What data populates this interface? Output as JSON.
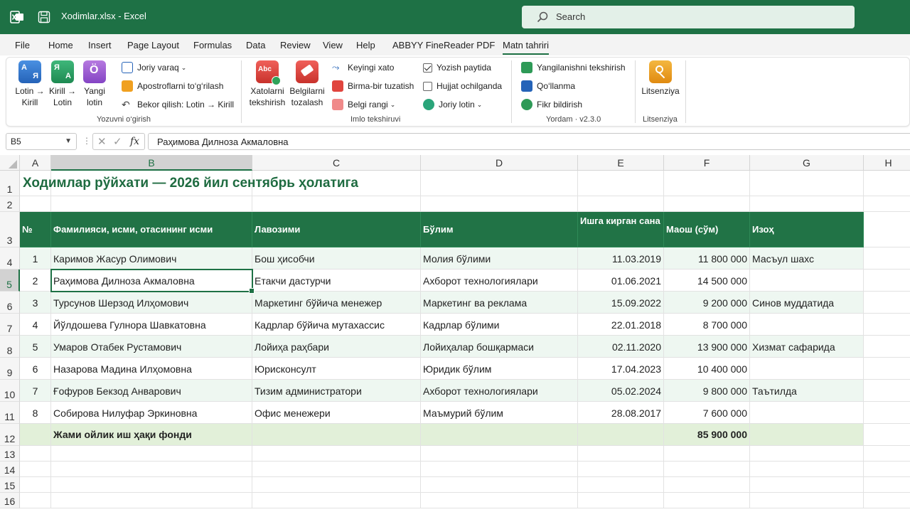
{
  "window": {
    "title": "Xodimlar.xlsx  -  Excel",
    "search_placeholder": "Search"
  },
  "menu": [
    "File",
    "Home",
    "Insert",
    "Page Layout",
    "Formulas",
    "Data",
    "Review",
    "View",
    "Help",
    "ABBYY FineReader PDF",
    "Matn tahriri"
  ],
  "active_menu": "Matn tahriri",
  "ribbon": {
    "group1": {
      "label": "Yozuvni o‘girish",
      "lotin_kirill": [
        "Lotin →",
        "Kirill"
      ],
      "kirill_lotin": [
        "Kirill →",
        "Lotin"
      ],
      "yangi_lotin": [
        "Yangi",
        "lotin"
      ],
      "joriy_varaq": "Joriy varaq",
      "apostrof": "Apostroflarni to‘g‘rilash",
      "bekor": "Bekor qilish: Lotin → Kirill"
    },
    "group2": {
      "label": "Imlo tekshiruvi",
      "xatolarni": [
        "Xatolarni",
        "tekshirish"
      ],
      "belgilarni": [
        "Belgilarni",
        "tozalash"
      ],
      "keyingi_xato": "Keyingi xato",
      "birma_bir": "Birma-bir tuzatish",
      "belgi_rangi": "Belgi rangi",
      "yozish_paytida": "Yozish paytida",
      "hujjat_ochilganda": "Hujjat ochilganda",
      "joriy_lotin": "Joriy lotin"
    },
    "group3": {
      "label": "Yordam · v2.3.0",
      "yangilanish": "Yangilanishni tekshirish",
      "qollanma": "Qo‘llanma",
      "fikr": "Fikr bildirish"
    },
    "group4": {
      "label": "Litsenziya",
      "litsenziya": "Litsenziya"
    }
  },
  "formula_bar": {
    "name_box": "B5",
    "formula": "Раҳимова Дилноза Акмаловна"
  },
  "columns": [
    "A",
    "B",
    "C",
    "D",
    "E",
    "F",
    "G",
    "H"
  ],
  "selected_column": "B",
  "selected_row": "5",
  "rows_numbers": [
    "1",
    "2",
    "3",
    "4",
    "5",
    "6",
    "7",
    "8",
    "9",
    "10",
    "11",
    "12",
    "13",
    "14",
    "15",
    "16"
  ],
  "sheet": {
    "title": "Ходимлар рўйхати — 2026 йил сентябрь ҳолатига",
    "headers": [
      "№",
      "Фамилияси, исми, отасининг исми",
      "Лавозими",
      "Бўлим",
      "Ишга кирган сана",
      "Маош (сўм)",
      "Изоҳ"
    ],
    "rows": [
      [
        "1",
        "Каримов Жасур Олимович",
        "Бош ҳисобчи",
        "Молия бўлими",
        "11.03.2019",
        "11 800 000",
        "Масъул шахс"
      ],
      [
        "2",
        "Раҳимова Дилноза Акмаловна",
        "Етакчи дастурчи",
        "Ахборот технологиялари",
        "01.06.2021",
        "14 500 000",
        ""
      ],
      [
        "3",
        "Турсунов Шерзод Илҳомович",
        "Маркетинг бўйича менежер",
        "Маркетинг ва реклама",
        "15.09.2022",
        "9 200 000",
        "Синов муддатида"
      ],
      [
        "4",
        "Йўлдошева Гулнора Шавкатовна",
        "Кадрлар бўйича мутахассис",
        "Кадрлар бўлими",
        "22.01.2018",
        "8 700 000",
        ""
      ],
      [
        "5",
        "Умаров Отабек Рустамович",
        "Лойиҳа раҳбари",
        "Лойиҳалар бошқармаси",
        "02.11.2020",
        "13 900 000",
        "Хизмат сафарида"
      ],
      [
        "6",
        "Назарова Мадина Илҳомовна",
        "Юрисконсулт",
        "Юридик бўлим",
        "17.04.2023",
        "10 400 000",
        ""
      ],
      [
        "7",
        "Ғофуров Бекзод Анварович",
        "Тизим администратори",
        "Ахборот технологиялари",
        "05.02.2024",
        "9 800 000",
        "Таътилда"
      ],
      [
        "8",
        "Собирова Нилуфар Эркиновна",
        "Офис менежери",
        "Маъмурий бўлим",
        "28.08.2017",
        "7 600 000",
        ""
      ]
    ],
    "total_label": "Жами ойлик иш ҳақи фонди",
    "total_value": "85 900 000"
  }
}
